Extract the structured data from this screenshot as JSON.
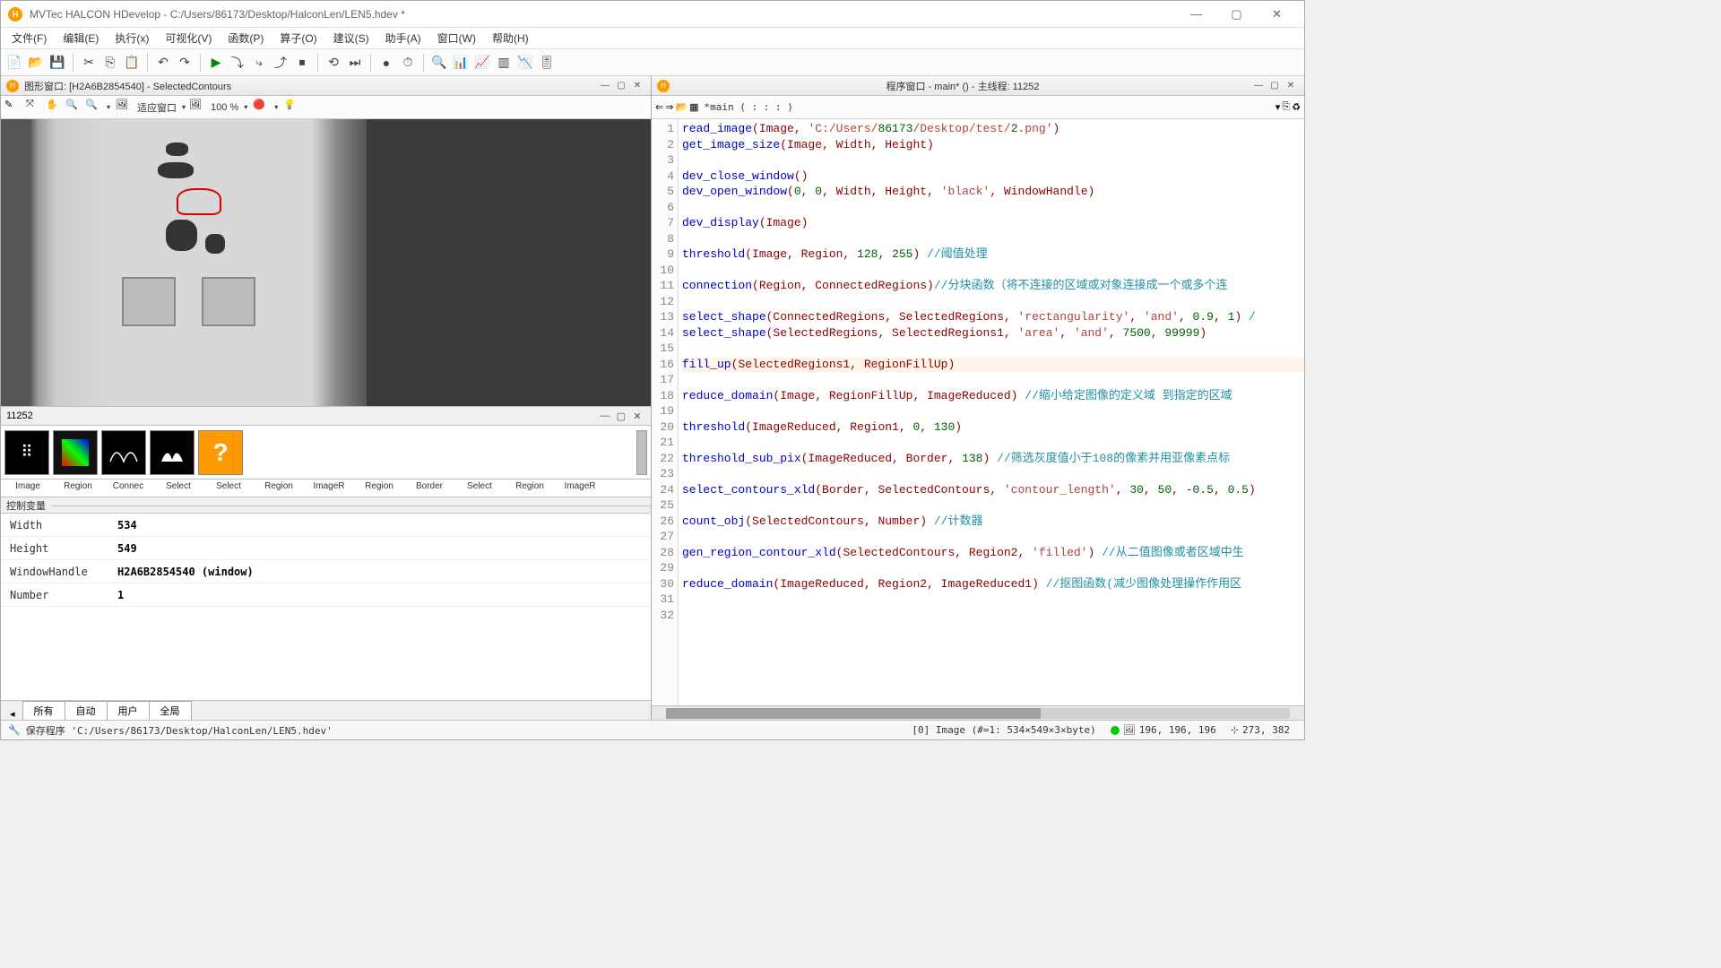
{
  "title": "MVTec HALCON HDevelop - C:/Users/86173/Desktop/HalconLen/LEN5.hdev *",
  "menus": [
    "文件(F)",
    "编辑(E)",
    "执行(x)",
    "可视化(V)",
    "函数(P)",
    "算子(O)",
    "建议(S)",
    "助手(A)",
    "窗口(W)",
    "帮助(H)"
  ],
  "graphic_title": "图形窗口: [H2A6B2854540] - SelectedContours",
  "fit_window": "适应窗口",
  "zoom_pct": "100 %",
  "thumbs_title": "11252",
  "thumb_labels": [
    "Image",
    "Region",
    "Connec",
    "Select",
    "Select",
    "Region",
    "ImageR",
    "Region",
    "Border",
    "Select",
    "Region",
    "ImageR"
  ],
  "ctrl_vars_header": "控制变量",
  "vars": [
    {
      "n": "Width",
      "v": "534"
    },
    {
      "n": "Height",
      "v": "549"
    },
    {
      "n": "WindowHandle",
      "v": "H2A6B2854540 (window)"
    },
    {
      "n": "Number",
      "v": "1"
    }
  ],
  "var_tabs": [
    "所有",
    "自动",
    "用户",
    "全局"
  ],
  "program_title": "程序窗口 - main* () - 主线程: 11252",
  "code_location": "*main ( : : : )",
  "code": [
    {
      "n": 1,
      "t": "read_image",
      "a": "(Image, 'C:/Users/86173/Desktop/test/2.png')"
    },
    {
      "n": 2,
      "t": "get_image_size",
      "a": "(Image, Width, Height)"
    },
    {
      "n": 3,
      "t": "",
      "a": ""
    },
    {
      "n": 4,
      "t": "dev_close_window",
      "a": "()"
    },
    {
      "n": 5,
      "t": "dev_open_window",
      "a": "(0, 0, Width, Height, 'black', WindowHandle)"
    },
    {
      "n": 6,
      "t": "",
      "a": ""
    },
    {
      "n": 7,
      "t": "dev_display",
      "a": "(Image)"
    },
    {
      "n": 8,
      "t": "",
      "a": ""
    },
    {
      "n": 9,
      "t": "threshold",
      "a": "(Image, Region, 128, 255)",
      "c": " //阈值处理"
    },
    {
      "n": 10,
      "t": "",
      "a": ""
    },
    {
      "n": 11,
      "t": "connection",
      "a": "(Region, ConnectedRegions)",
      "c": "//分块函数（将不连接的区域或对象连接成一个或多个连"
    },
    {
      "n": 12,
      "t": "",
      "a": ""
    },
    {
      "n": 13,
      "t": "select_shape",
      "a": "(ConnectedRegions, SelectedRegions, 'rectangularity', 'and', 0.9, 1)",
      "c": " /",
      "mark": "green"
    },
    {
      "n": 14,
      "t": "select_shape",
      "a": "(SelectedRegions, SelectedRegions1, 'area', 'and', 7500, 99999)"
    },
    {
      "n": 15,
      "t": "",
      "a": ""
    },
    {
      "n": 16,
      "t": "fill_up",
      "a": "(SelectedRegions1, RegionFillUp)",
      "hl": true
    },
    {
      "n": 17,
      "t": "",
      "a": "",
      "mark": "dark"
    },
    {
      "n": 18,
      "t": "reduce_domain",
      "a": "(Image, RegionFillUp, ImageReduced)",
      "c": " //缩小给定图像的定义域 到指定的区域"
    },
    {
      "n": 19,
      "t": "",
      "a": ""
    },
    {
      "n": 20,
      "t": "threshold",
      "a": "(ImageReduced, Region1, 0, 130)"
    },
    {
      "n": 21,
      "t": "",
      "a": ""
    },
    {
      "n": 22,
      "t": "threshold_sub_pix",
      "a": "(ImageReduced, Border, 138)",
      "c": " //筛选灰度值小于108的像素并用亚像素点标"
    },
    {
      "n": 23,
      "t": "",
      "a": ""
    },
    {
      "n": 24,
      "t": "select_contours_xld",
      "a": "(Border, SelectedContours, 'contour_length', 30, 50, -0.5, 0.5)"
    },
    {
      "n": 25,
      "t": "",
      "a": ""
    },
    {
      "n": 26,
      "t": "count_obj",
      "a": "(SelectedContours, Number)",
      "c": " //计数器"
    },
    {
      "n": 27,
      "t": "",
      "a": ""
    },
    {
      "n": 28,
      "t": "gen_region_contour_xld",
      "a": "(SelectedContours, Region2, 'filled')",
      "c": " //从二值图像或者区域中生"
    },
    {
      "n": 29,
      "t": "",
      "a": ""
    },
    {
      "n": 30,
      "t": "reduce_domain",
      "a": "(ImageReduced, Region2, ImageReduced1)",
      "c": " //抠图函数(减少图像处理操作作用区"
    },
    {
      "n": 31,
      "t": "",
      "a": ""
    },
    {
      "n": 32,
      "t": "",
      "a": ""
    }
  ],
  "status_left": "保存程序 'C:/Users/86173/Desktop/HalconLen/LEN5.hdev'",
  "status_img": "[0] Image (#=1: 534×549×3×byte)",
  "status_rgb": "196, 196, 196",
  "status_coord": "273, 382"
}
